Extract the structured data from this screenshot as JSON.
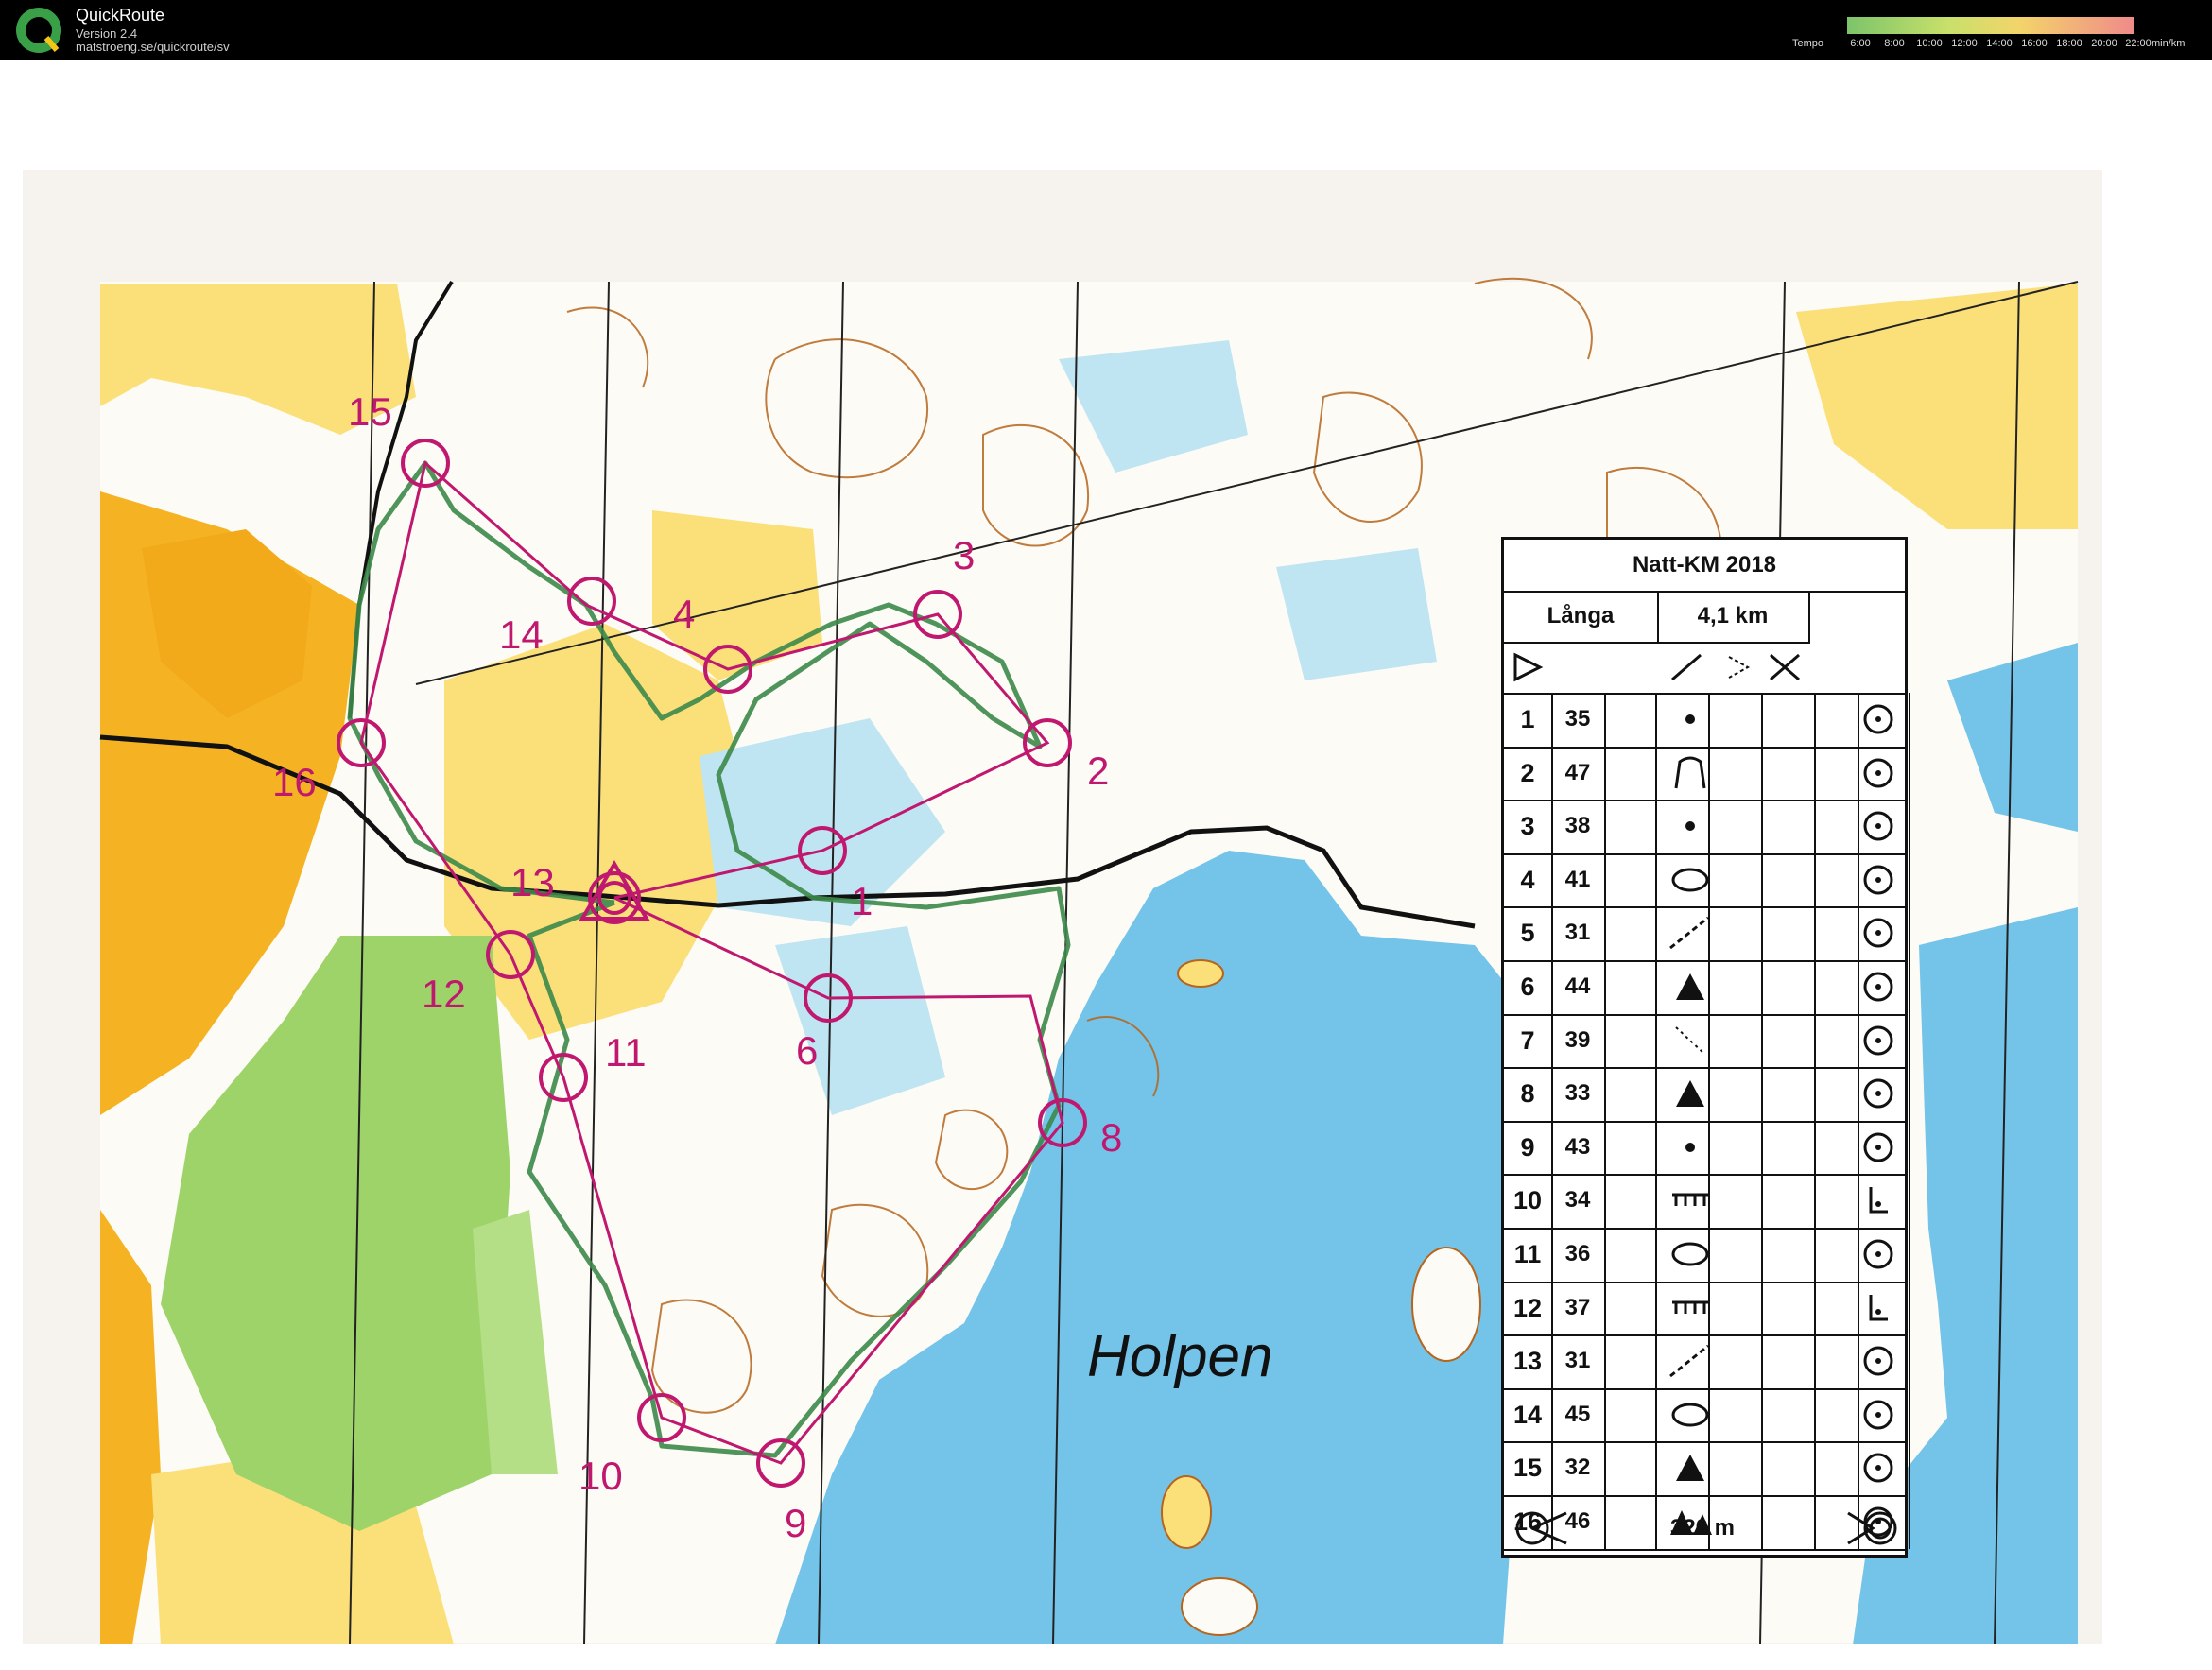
{
  "app": {
    "name": "QuickRoute",
    "version": "Version 2.4",
    "url": "matstroeng.se/quickroute/sv",
    "tempo_label": "Tempo",
    "tempo_ticks": [
      "6:00",
      "8:00",
      "10:00",
      "12:00",
      "14:00",
      "16:00",
      "18:00",
      "20:00",
      "22:00"
    ],
    "tempo_unit": "min/km"
  },
  "map": {
    "lake_name": "Holpen",
    "control_labels": [
      "1",
      "2",
      "3",
      "4",
      "6",
      "8",
      "9",
      "10",
      "11",
      "12",
      "13",
      "14",
      "15",
      "16"
    ]
  },
  "control_box": {
    "title": "Natt-KM 2018",
    "class_name": "Långa",
    "course_length": "4,1 km",
    "finish_distance": "320 m",
    "rows": [
      {
        "num": "1",
        "code": "35"
      },
      {
        "num": "2",
        "code": "47"
      },
      {
        "num": "3",
        "code": "38"
      },
      {
        "num": "4",
        "code": "41"
      },
      {
        "num": "5",
        "code": "31"
      },
      {
        "num": "6",
        "code": "44"
      },
      {
        "num": "7",
        "code": "39"
      },
      {
        "num": "8",
        "code": "33"
      },
      {
        "num": "9",
        "code": "43"
      },
      {
        "num": "10",
        "code": "34"
      },
      {
        "num": "11",
        "code": "36"
      },
      {
        "num": "12",
        "code": "37"
      },
      {
        "num": "13",
        "code": "31"
      },
      {
        "num": "14",
        "code": "45"
      },
      {
        "num": "15",
        "code": "32"
      },
      {
        "num": "16",
        "code": "46"
      }
    ]
  },
  "colors": {
    "open_land": "#f5b323",
    "rough_open": "#fbe07a",
    "forest_green": "#9ed36a",
    "water": "#74c4ea",
    "course": "#c0186f",
    "route": "#3c8a4a"
  }
}
